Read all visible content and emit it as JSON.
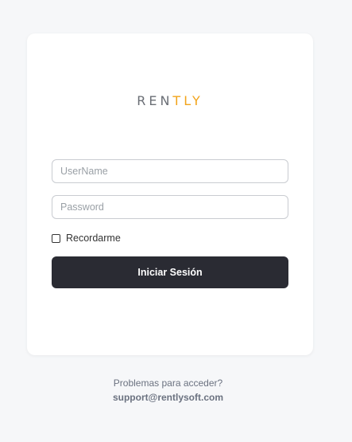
{
  "brand": {
    "logo_part1": "REN",
    "logo_part2": "TLY",
    "primary_color": "#2a2b33",
    "accent_color": "#f2a41b"
  },
  "form": {
    "username": {
      "placeholder": "UserName",
      "value": ""
    },
    "password": {
      "placeholder": "Password",
      "value": ""
    },
    "remember_label": "Recordarme",
    "remember_checked": false,
    "submit_label": "Iniciar Sesión"
  },
  "footer": {
    "help_text": "Problemas para acceder?",
    "support_email": "support@rentlysoft.com"
  }
}
